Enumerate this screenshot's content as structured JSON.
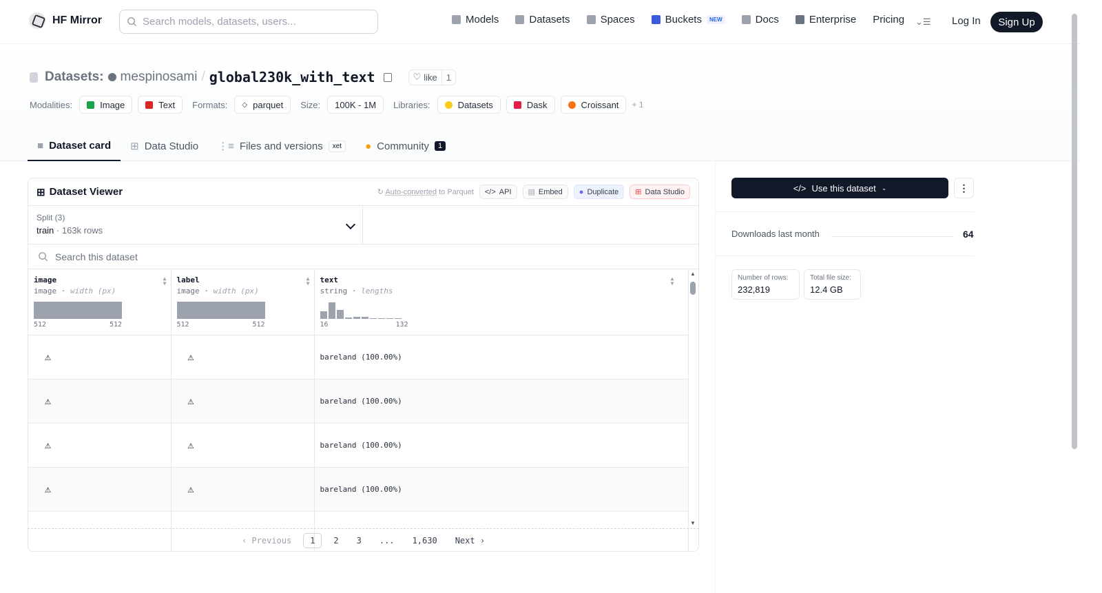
{
  "nav": {
    "brand": "HF Mirror",
    "search_placeholder": "Search models, datasets, users...",
    "items": [
      {
        "label": "Models",
        "icon": "cube-icon"
      },
      {
        "label": "Datasets",
        "icon": "database-icon"
      },
      {
        "label": "Spaces",
        "icon": "grid-icon"
      },
      {
        "label": "Buckets",
        "icon": "bucket-icon",
        "badge": "NEW"
      },
      {
        "label": "Docs",
        "icon": "book-icon"
      },
      {
        "label": "Enterprise",
        "icon": "enterprise-icon"
      },
      {
        "label": "Pricing"
      }
    ],
    "login": "Log In",
    "signup": "Sign Up"
  },
  "header": {
    "section": "Datasets:",
    "owner": "mespinosami",
    "sep": "/",
    "name": "global230k_with_text",
    "like_label": "like",
    "like_count": "1",
    "modalities_label": "Modalities:",
    "modalities": [
      "Image",
      "Text"
    ],
    "formats_label": "Formats:",
    "format": "parquet",
    "size_label": "Size:",
    "size": "100K - 1M",
    "libraries_label": "Libraries:",
    "libraries": [
      "Datasets",
      "Dask",
      "Croissant"
    ],
    "libraries_more": "+ 1"
  },
  "tabs": [
    {
      "label": "Dataset card",
      "active": true
    },
    {
      "label": "Data Studio"
    },
    {
      "label": "Files and versions",
      "badge": "xet"
    },
    {
      "label": "Community",
      "count": "1"
    }
  ],
  "viewer": {
    "title": "Dataset Viewer",
    "auto_link": "Auto-converted",
    "auto_rest": " to Parquet",
    "api": "API",
    "embed": "Embed",
    "duplicate": "Duplicate",
    "data_studio": "Data Studio",
    "split_label": "Split (3)",
    "split_value": "train",
    "split_rows": "163k rows",
    "search_placeholder": "Search this dataset",
    "columns": [
      {
        "name": "image",
        "type": "image",
        "stat": "width (px)",
        "min": "512",
        "max": "512"
      },
      {
        "name": "label",
        "type": "image",
        "stat": "width (px)",
        "min": "512",
        "max": "512"
      },
      {
        "name": "text",
        "type": "string",
        "stat": "lengths",
        "min": "16",
        "max": "132"
      }
    ],
    "text_hist": [
      0.45,
      0.95,
      0.5,
      0.08,
      0.12,
      0.1,
      0.05,
      0.05,
      0.04,
      0.04
    ],
    "rows": [
      {
        "text": "bareland (100.00%)"
      },
      {
        "text": "bareland (100.00%)"
      },
      {
        "text": "bareland (100.00%)"
      },
      {
        "text": "bareland (100.00%)"
      },
      {
        "text": ""
      }
    ],
    "pager": {
      "prev": "Previous",
      "pages": [
        "1",
        "2",
        "3",
        "...",
        "1,630"
      ],
      "next": "Next"
    }
  },
  "sidebar": {
    "use_button": "Use this dataset",
    "downloads_label": "Downloads last month",
    "downloads_value": "64",
    "rows_label": "Number of rows:",
    "rows_value": "232,819",
    "size_label": "Total file size:",
    "size_value": "12.4 GB"
  }
}
